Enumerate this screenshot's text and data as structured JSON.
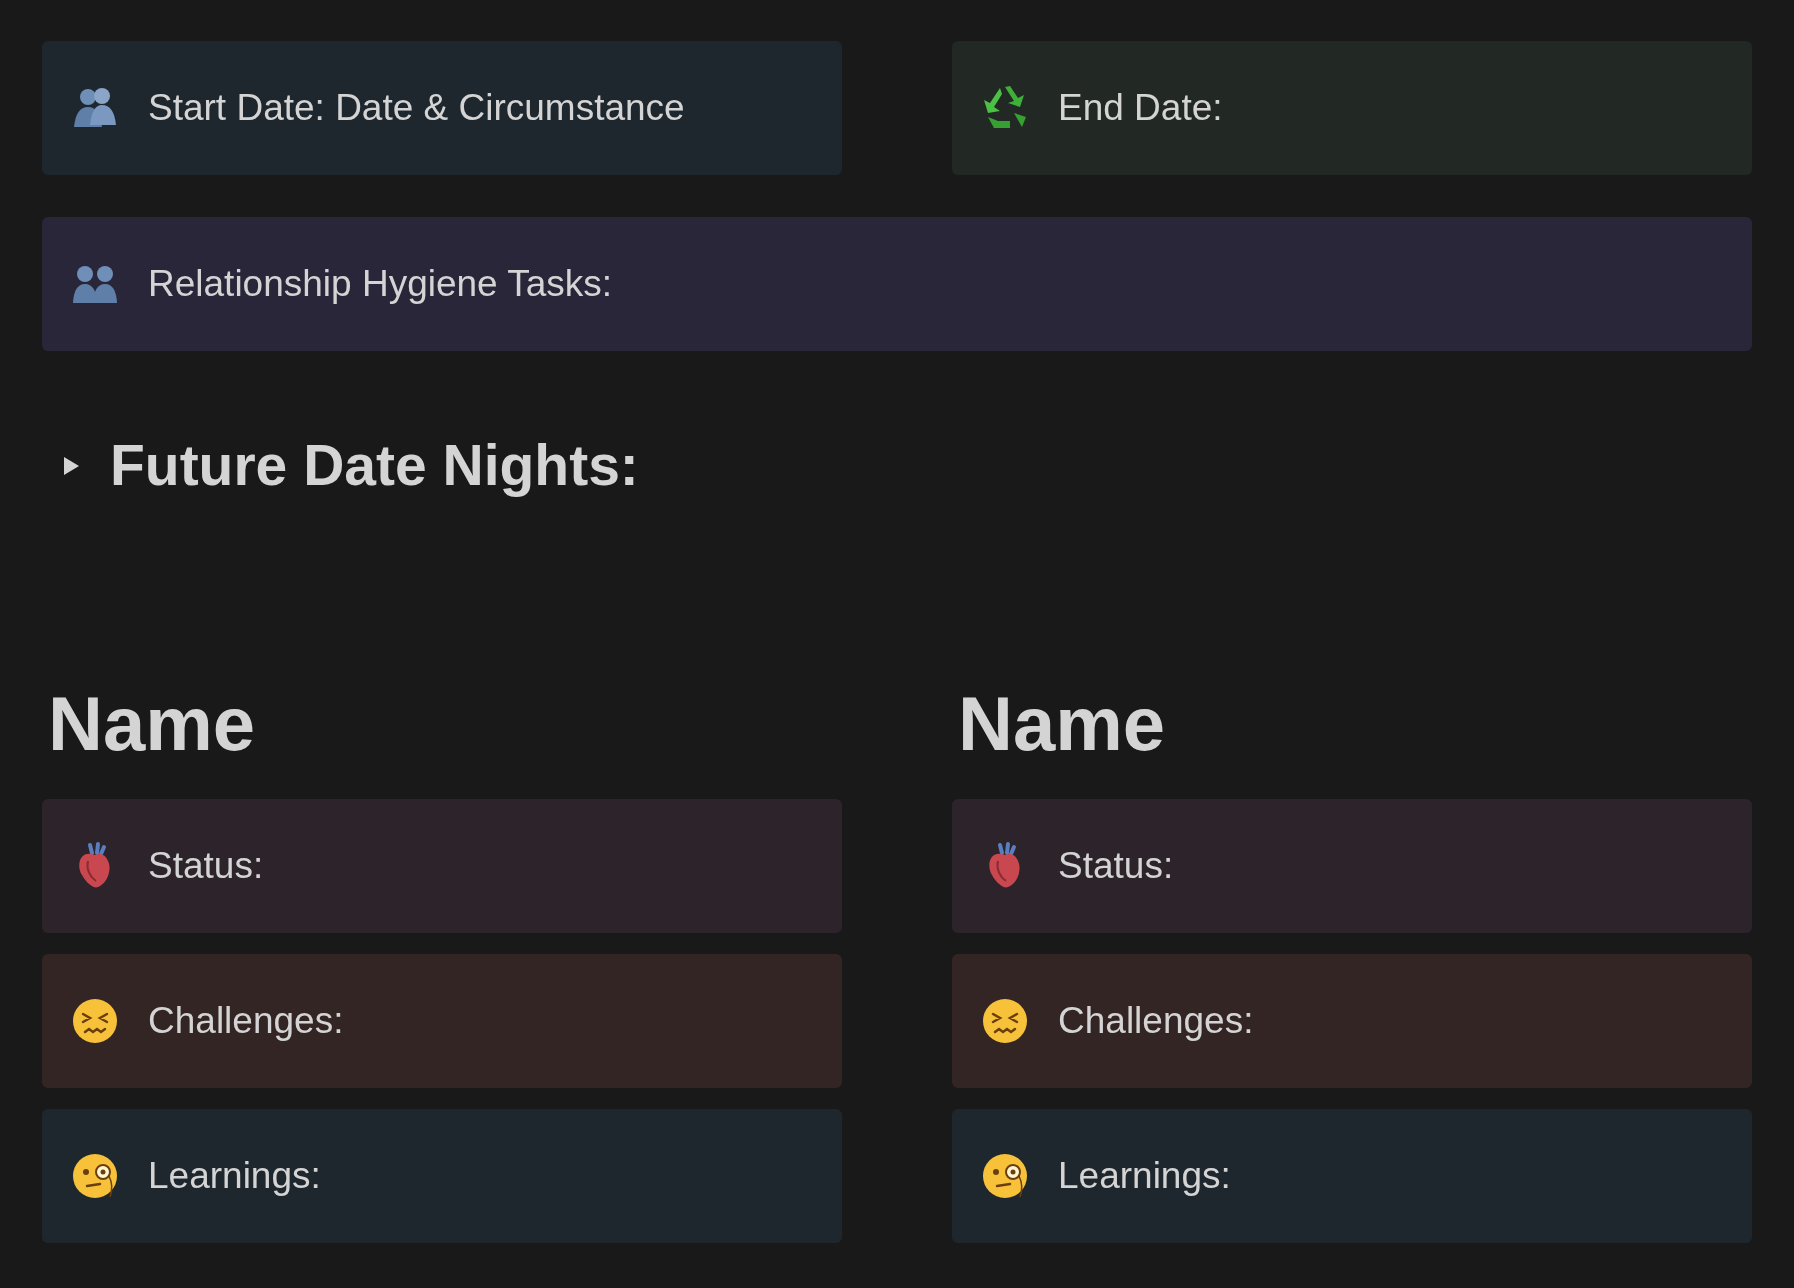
{
  "top_callouts": [
    {
      "kind": "couple",
      "color": "#1f272e",
      "text": "Start Date: Date & Circumstance"
    },
    {
      "kind": "recycle",
      "color": "#222924",
      "text": "End Date:"
    }
  ],
  "tasks_callout": {
    "kind": "people",
    "color": "#29263a",
    "text": "Relationship Hygiene Tasks:"
  },
  "toggle": {
    "title": "Future Date Nights:",
    "expanded": false
  },
  "columns": [
    {
      "heading": "Name",
      "callouts": [
        {
          "kind": "heart",
          "color": "#2d232b",
          "text": "Status:"
        },
        {
          "kind": "confounded",
          "color": "#332524",
          "text": "Challenges:"
        },
        {
          "kind": "monocle",
          "color": "#1f272e",
          "text": "Learnings:"
        }
      ]
    },
    {
      "heading": "Name",
      "callouts": [
        {
          "kind": "heart",
          "color": "#2d232b",
          "text": "Status:"
        },
        {
          "kind": "confounded",
          "color": "#332524",
          "text": "Challenges:"
        },
        {
          "kind": "monocle",
          "color": "#1f272e",
          "text": "Learnings:"
        }
      ]
    }
  ]
}
